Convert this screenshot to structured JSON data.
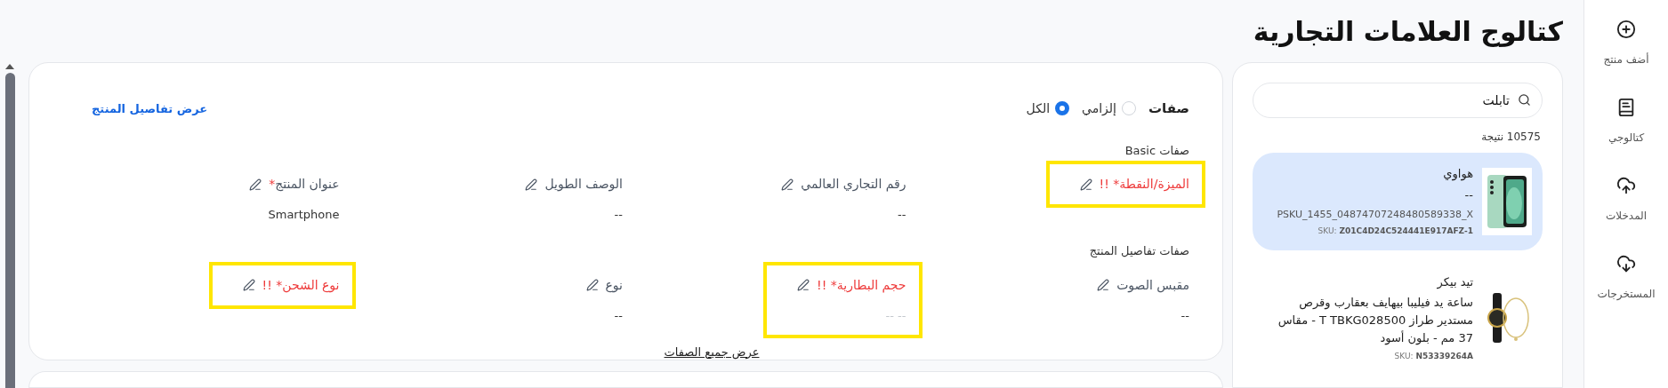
{
  "nav": [
    {
      "kind": "add",
      "label": "أضف منتج"
    },
    {
      "kind": "catalog",
      "label": "كتالوجي"
    },
    {
      "kind": "upload",
      "label": "المدخلات"
    },
    {
      "kind": "download",
      "label": "المستخرجات"
    }
  ],
  "page_title": "كتالوج العلامات التجارية",
  "search": {
    "value": "تابلت"
  },
  "result_count": "10575 نتيجة",
  "products": [
    {
      "selected": true,
      "brand": "هواوي",
      "subtitle": "--",
      "psku": "PSKU_1455_04874707248480589338_X",
      "sku_label": "SKU:",
      "sku": "Z01C4D24C524441E917AFZ-1",
      "image": {
        "kind": "phone"
      }
    },
    {
      "selected": false,
      "brand": "تيد بيكر",
      "subtitle": "ساعة يد فيليبا بيهايف بعقارب وقرص مستدير طراز T TBKG028500 - مقاس 37 مم - بلون أسود",
      "sku_label": "SKU:",
      "sku": "N53339264A",
      "image": {
        "kind": "watch"
      }
    }
  ],
  "details": {
    "filter_label": "صفات",
    "filter_options": [
      {
        "label": "إلزامي",
        "selected": false
      },
      {
        "label": "الكل",
        "selected": true
      }
    ],
    "link": "عرض تفاصيل المنتج",
    "sections": [
      {
        "title": "صفات Basic",
        "attributes": [
          {
            "label": "الميزة/النقطة* !!",
            "error": true,
            "highlighted": true
          },
          {
            "label": "رقم التجاري العالمي",
            "error": false,
            "highlighted": false,
            "value": "--"
          },
          {
            "label": "الوصف الطويل",
            "error": false,
            "highlighted": false,
            "value": "--"
          },
          {
            "label": "عنوان المنتج",
            "required_mark": "*",
            "error": false,
            "highlighted": false,
            "value": "Smartphone"
          }
        ]
      },
      {
        "title": "صفات تفاصيل المنتج",
        "attributes": [
          {
            "label": "مقبس الصوت",
            "error": false,
            "highlighted": false,
            "value": "--"
          },
          {
            "label": "حجم البطارية* !!",
            "error": true,
            "highlighted": true,
            "value": "-- --"
          },
          {
            "label": "نوع",
            "error": false,
            "highlighted": false,
            "value": "--"
          },
          {
            "label": "نوع الشحن* !!",
            "error": true,
            "highlighted": true
          }
        ]
      }
    ],
    "show_all": "عرض جميع الصفات"
  }
}
